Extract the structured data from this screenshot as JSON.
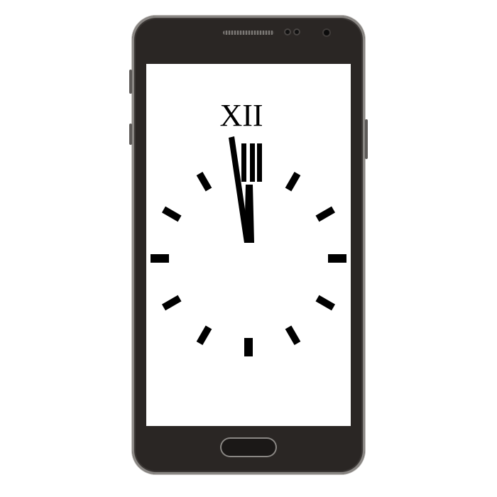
{
  "device": {
    "body_color": "#2a2624",
    "screen_color": "#ffffff"
  },
  "clock": {
    "numeral_twelve": "XII",
    "marker_color": "#000000",
    "hour_markers": [
      1,
      2,
      3,
      4,
      5,
      6,
      7,
      8,
      9,
      10,
      11
    ],
    "time": {
      "hour": 12,
      "minute": 0
    }
  }
}
